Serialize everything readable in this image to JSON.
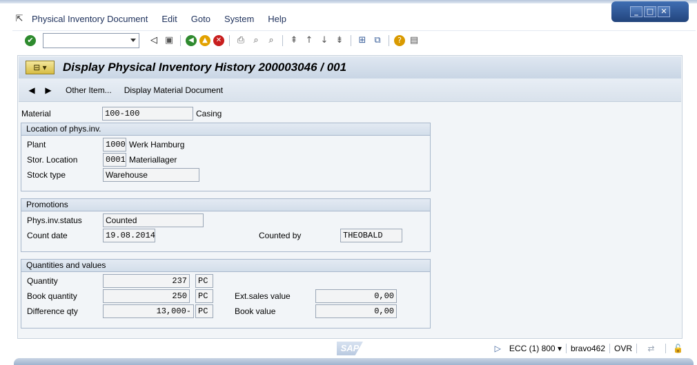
{
  "window": {
    "minimize": "_",
    "maximize": "□",
    "close": "✕"
  },
  "menu": {
    "items": [
      "Physical Inventory Document",
      "Edit",
      "Goto",
      "System",
      "Help"
    ]
  },
  "toolbar": {
    "command_field_value": ""
  },
  "title": {
    "text": "Display Physical Inventory History 200003046 / 001"
  },
  "app_toolbar": {
    "other_item": "Other Item...",
    "display_material_document": "Display Material Document"
  },
  "header": {
    "material_label": "Material",
    "material_value": "100-100",
    "material_desc": "Casing"
  },
  "location": {
    "heading": "Location of phys.inv.",
    "plant_label": "Plant",
    "plant_value": "1000",
    "plant_desc": "Werk Hamburg",
    "sloc_label": "Stor. Location",
    "sloc_value": "0001",
    "sloc_desc": "Materiallager",
    "stock_type_label": "Stock type",
    "stock_type_value": "Warehouse"
  },
  "promotions": {
    "heading": "Promotions",
    "status_label": "Phys.inv.status",
    "status_value": "Counted",
    "count_date_label": "Count date",
    "count_date_value": "19.08.2014",
    "counted_by_label": "Counted by",
    "counted_by_value": "THEOBALD"
  },
  "quantities": {
    "heading": "Quantities and values",
    "quantity_label": "Quantity",
    "quantity_value": "237",
    "quantity_unit": "PC",
    "book_qty_label": "Book quantity",
    "book_qty_value": "250",
    "book_qty_unit": "PC",
    "diff_qty_label": "Difference qty",
    "diff_qty_value": "13,000-",
    "diff_qty_unit": "PC",
    "ext_sales_label": "Ext.sales value",
    "ext_sales_value": "0,00",
    "book_value_label": "Book value",
    "book_value_value": "0,00"
  },
  "status": {
    "logo": "SAP",
    "system": "ECC (1) 800",
    "server": "bravo462",
    "mode": "OVR"
  }
}
